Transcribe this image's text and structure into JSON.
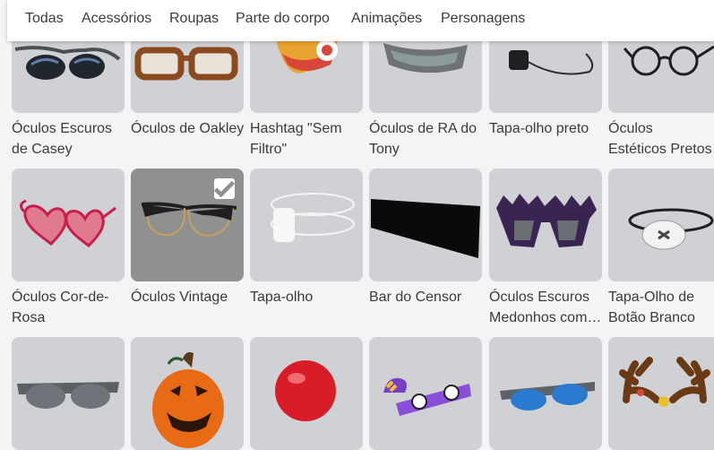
{
  "tabs": [
    "Todas",
    "Acessórios",
    "Roupas",
    "Parte do corpo",
    "Animações",
    "Personagens"
  ],
  "items_row1": [
    {
      "name": "Óculos Escuros de Casey",
      "icon": "sunglasses-icon"
    },
    {
      "name": "Óculos de Oakley",
      "icon": "brown-glasses-icon"
    },
    {
      "name": "Hashtag \"Sem Filtro\"",
      "icon": "hashtag-mask-icon"
    },
    {
      "name": "Óculos de RA do Tony",
      "icon": "ar-visor-icon"
    },
    {
      "name": "Tapa-olho preto",
      "icon": "eyepatch-icon"
    },
    {
      "name": "Óculos Estéticos Pretos",
      "icon": "round-glasses-icon"
    }
  ],
  "items_row2": [
    {
      "name": "Óculos Cor-de-Rosa",
      "icon": "heart-glasses-icon",
      "selected": false
    },
    {
      "name": "Óculos Vintage",
      "icon": "vintage-glasses-icon",
      "selected": true
    },
    {
      "name": "Tapa-olho",
      "icon": "white-eyepatch-icon",
      "selected": false
    },
    {
      "name": "Bar do Censor",
      "icon": "censor-bar-icon",
      "selected": false
    },
    {
      "name": "Óculos Escuros Medonhos com…",
      "icon": "spiky-glasses-icon",
      "selected": false
    },
    {
      "name": "Tapa-Olho de Botão Branco",
      "icon": "button-eyepatch-icon",
      "selected": false
    }
  ],
  "items_row3": [
    {
      "icon": "gray-sunglasses-icon"
    },
    {
      "icon": "pumpkin-icon"
    },
    {
      "icon": "red-nose-icon"
    },
    {
      "icon": "purple-glasses-icon"
    },
    {
      "icon": "blue-sunglasses-icon"
    },
    {
      "icon": "antlers-icon"
    }
  ]
}
